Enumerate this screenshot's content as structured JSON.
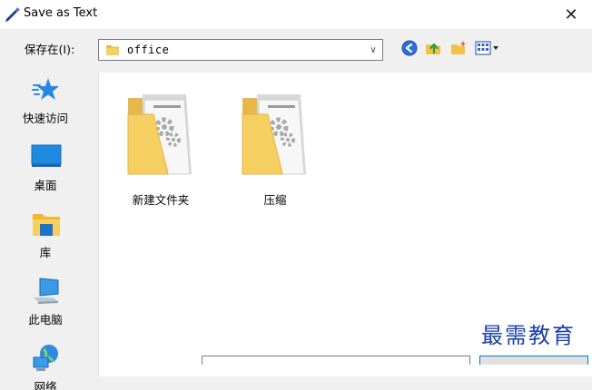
{
  "window": {
    "title": "Save as Text",
    "close_glyph": "✕"
  },
  "lookin": {
    "label": "保存在(I):",
    "value": "office",
    "dropdown_glyph": "∨"
  },
  "toolbar": {
    "back_icon": "back-arrow-icon",
    "up_icon": "up-one-level-icon",
    "new_folder_icon": "new-folder-icon",
    "view_menu_icon": "view-menu-icon"
  },
  "places": [
    {
      "label": "快速访问",
      "icon": "star-icon"
    },
    {
      "label": "桌面",
      "icon": "desktop-icon"
    },
    {
      "label": "库",
      "icon": "library-icon"
    },
    {
      "label": "此电脑",
      "icon": "computer-icon"
    },
    {
      "label": "网络",
      "icon": "network-icon"
    }
  ],
  "files": [
    {
      "name": "新建文件夹",
      "icon": "folder-icon"
    },
    {
      "name": "压缩",
      "icon": "folder-icon"
    }
  ],
  "watermark": "最需教育",
  "colors": {
    "accent": "#0078d7",
    "folder": "#f6cf62",
    "watermark": "#1a3fa8"
  }
}
